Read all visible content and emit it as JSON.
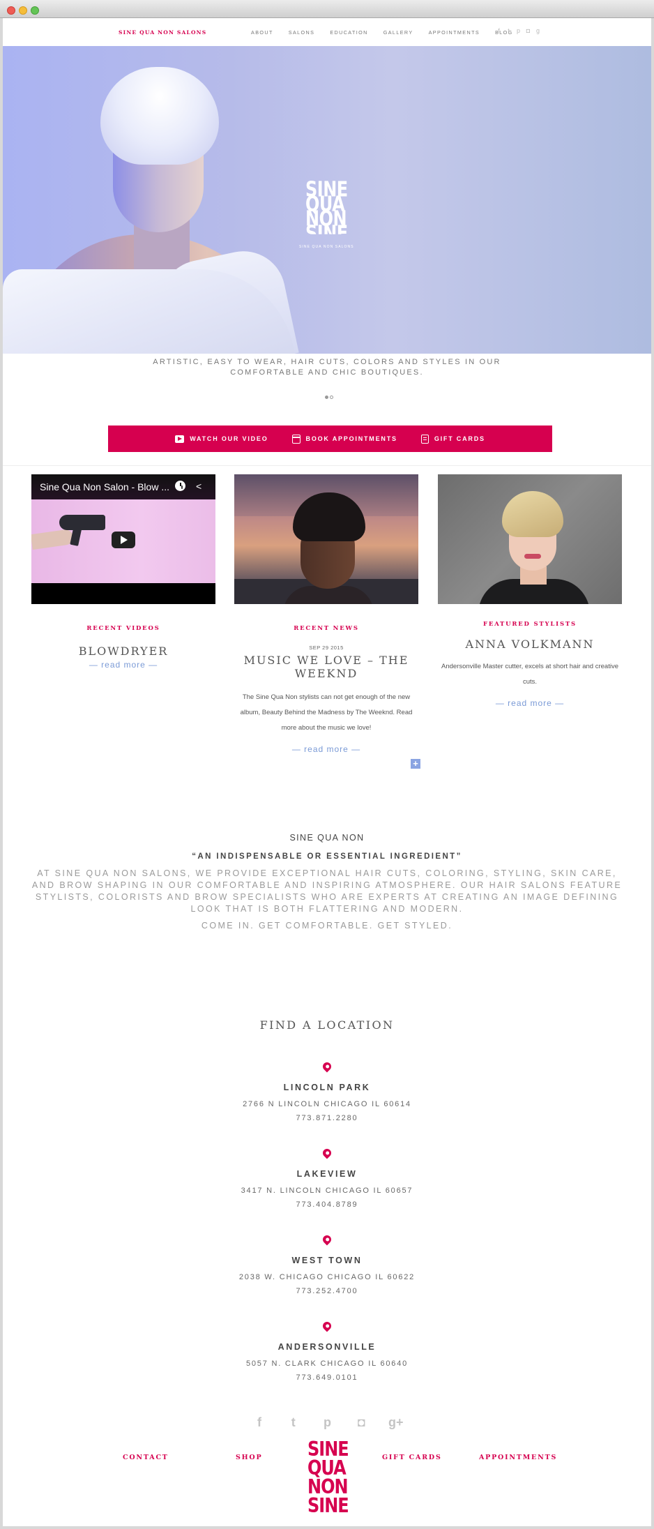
{
  "header": {
    "brand": "SINE QUA NON SALONS",
    "nav": [
      "ABOUT",
      "SALONS",
      "EDUCATION",
      "GALLERY",
      "APPOINTMENTS",
      "BLOG"
    ],
    "social_icons": [
      "facebook-icon",
      "twitter-icon",
      "pinterest-icon",
      "instagram-icon",
      "google-plus-icon"
    ]
  },
  "hero": {
    "logo_lines": [
      "SINE",
      "QUA",
      "NON",
      "SINE"
    ],
    "logo_sub": "SINE QUA NON SALONS",
    "tagline": "ARTISTIC, EASY TO WEAR, HAIR CUTS, COLORS AND STYLES IN OUR COMFORTABLE AND CHIC BOUTIQUES.",
    "slides": 2,
    "active_slide": 1
  },
  "actions": {
    "watch": "WATCH OUR VIDEO",
    "book": "BOOK APPOINTMENTS",
    "gift": "GIFT CARDS"
  },
  "columns": {
    "videos": {
      "video_title": "Sine Qua Non Salon - Blow ...",
      "label": "RECENT VIDEOS",
      "title": "BLOWDRYER",
      "readmore": "— read more —"
    },
    "news": {
      "label": "RECENT NEWS",
      "date": "SEP 29 2015",
      "title": "MUSIC WE LOVE – THE WEEKND",
      "text": "The Sine Qua Non stylists can not get enough of the new album, Beauty Behind the Madness by The Weeknd. Read more about the music we love!",
      "readmore": "— read more —",
      "plus": "+"
    },
    "stylists": {
      "label": "FEATURED STYLISTS",
      "title": "ANNA VOLKMANN",
      "text": "Andersonville Master cutter, excels at short hair and creative cuts.",
      "readmore": "— read more —"
    }
  },
  "about": {
    "title": "SINE QUA NON",
    "quote": "“AN INDISPENSABLE OR ESSENTIAL INGREDIENT”",
    "text": "AT SINE QUA NON SALONS, WE PROVIDE EXCEPTIONAL HAIR CUTS, COLORING, STYLING, SKIN CARE, AND BROW SHAPING IN OUR COMFORTABLE AND INSPIRING ATMOSPHERE. OUR HAIR SALONS FEATURE STYLISTS, COLORISTS AND BROW SPECIALISTS WHO ARE EXPERTS AT CREATING AN IMAGE DEFINING LOOK THAT IS BOTH FLATTERING AND MODERN.",
    "cta": "COME IN. GET COMFORTABLE. GET STYLED."
  },
  "locations": {
    "heading": "FIND A LOCATION",
    "items": [
      {
        "name": "LINCOLN PARK",
        "address": "2766 N LINCOLN CHICAGO IL 60614",
        "phone": "773.871.2280"
      },
      {
        "name": "LAKEVIEW",
        "address": "3417 N. LINCOLN CHICAGO IL 60657",
        "phone": "773.404.8789"
      },
      {
        "name": "WEST TOWN",
        "address": "2038 W. CHICAGO CHICAGO IL 60622",
        "phone": "773.252.4700"
      },
      {
        "name": "ANDERSONVILLE",
        "address": "5057 N. CLARK CHICAGO IL 60640",
        "phone": "773.649.0101"
      }
    ]
  },
  "footer": {
    "social_icons": [
      "facebook-icon",
      "twitter-icon",
      "pinterest-icon",
      "instagram-icon",
      "google-plus-icon"
    ],
    "links": [
      "CONTACT",
      "SHOP",
      "GIFT CARDS",
      "APPOINTMENTS"
    ],
    "logo_lines": [
      "SINE",
      "QUA",
      "NON",
      "SINE"
    ]
  },
  "colors": {
    "accent": "#d6004f",
    "link": "#7a9ad6",
    "text": "#555555"
  }
}
